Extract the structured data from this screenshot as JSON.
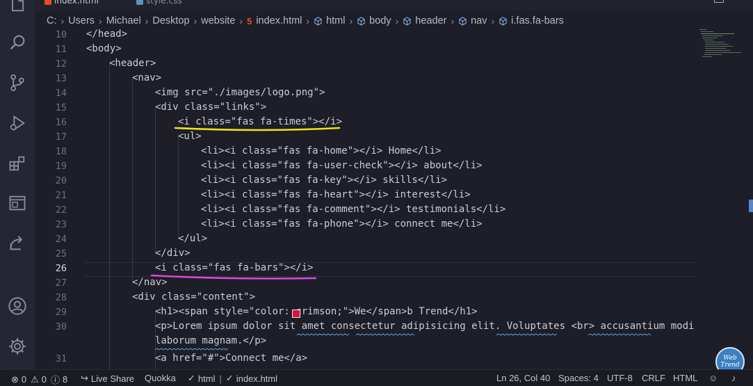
{
  "tabs": [
    {
      "label": "index.html",
      "active": true,
      "icon": "html-file-icon",
      "color": "#e44d26"
    },
    {
      "label": "style.css",
      "active": false,
      "icon": "css-file-icon",
      "color": "#519aba"
    }
  ],
  "breadcrumb": {
    "path": [
      "C:",
      "Users",
      "Michael",
      "Desktop",
      "website",
      "index.html",
      "html",
      "body",
      "header",
      "nav",
      "i.fas.fa-bars"
    ]
  },
  "editor": {
    "current_line": 26,
    "lines": [
      {
        "num": "10",
        "text": "</head>"
      },
      {
        "num": "11",
        "text": "<body>"
      },
      {
        "num": "12",
        "text": "<header>"
      },
      {
        "num": "13",
        "text": "<nav>"
      },
      {
        "num": "14",
        "text": "<img src=\"./images/logo.png\">"
      },
      {
        "num": "15",
        "text": "<div class=\"links\">"
      },
      {
        "num": "16",
        "text": "<i class=\"fas fa-times\"></i>"
      },
      {
        "num": "17",
        "text": "<ul>"
      },
      {
        "num": "18",
        "text": "<li><i class=\"fas fa-home\"></i> Home</li>"
      },
      {
        "num": "19",
        "text": "<li><i class=\"fas fa-user-check\"></i> about</li>"
      },
      {
        "num": "20",
        "text": "<li><i class=\"fas fa-key\"></i> skills</li>"
      },
      {
        "num": "21",
        "text": "<li><i class=\"fas fa-heart\"></i> interest</li>"
      },
      {
        "num": "22",
        "text": "<li><i class=\"fas fa-comment\"></i> testimonials</li>"
      },
      {
        "num": "23",
        "text": "<li><i class=\"fas fa-phone\"></i> connect me</li>"
      },
      {
        "num": "24",
        "text": "</ul>"
      },
      {
        "num": "25",
        "text": "</div>"
      },
      {
        "num": "26",
        "text": "<i class=\"fas fa-bars\"></i>"
      },
      {
        "num": "27",
        "text": "</nav>"
      },
      {
        "num": "28",
        "text": "<div class=\"content\">"
      },
      {
        "num": "29",
        "text": "<h1><span style=\"color: crimson;\">We</span>b Trend</h1>"
      },
      {
        "num": "30",
        "text": "<p>Lorem ipsum dolor sit amet consectetur adipisicing elit. Voluptates <br> accusantium modi"
      },
      {
        "num": "",
        "text": "laborum magnam.</p>"
      },
      {
        "num": "31",
        "text": "<a href=\"#\">Connect me</a>"
      }
    ],
    "colors": {
      "crimson_swatch": "#dc143c",
      "yellow_underline": "#f2e21a",
      "pink_underline": "#e046e0"
    }
  },
  "statusbar": {
    "errors": "0",
    "warnings": "0",
    "info": "8",
    "live_share": "Live Share",
    "quokka": "Quokka",
    "html_check": "html",
    "file_check": "index.html",
    "position": "Ln 26, Col 40",
    "spaces": "Spaces: 4",
    "encoding": "UTF-8",
    "eol": "CRLF",
    "language": "HTML"
  },
  "watermark": {
    "line1": "Web",
    "line2": "Trend"
  }
}
